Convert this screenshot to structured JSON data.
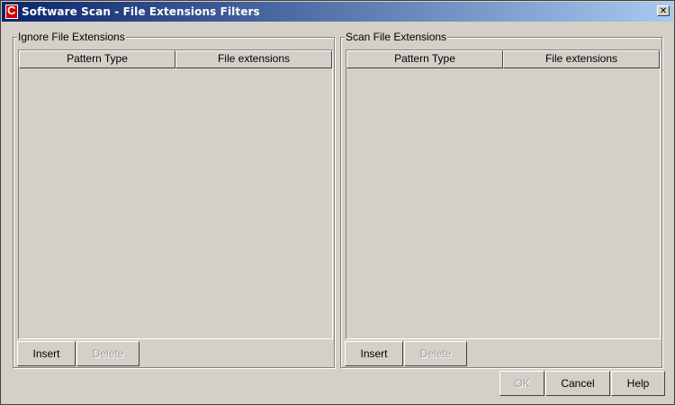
{
  "window": {
    "title": "Software Scan - File Extensions Filters",
    "close_glyph": "✕"
  },
  "ignore_panel": {
    "label": "Ignore File Extensions",
    "columns": [
      "Pattern Type",
      "File extensions"
    ],
    "rows": [],
    "insert_label": "Insert",
    "delete_label": "Delete"
  },
  "scan_panel": {
    "label": "Scan File Extensions",
    "columns": [
      "Pattern Type",
      "File extensions"
    ],
    "rows": [],
    "insert_label": "Insert",
    "delete_label": "Delete"
  },
  "footer": {
    "ok_label": "OK",
    "cancel_label": "Cancel",
    "help_label": "Help"
  }
}
